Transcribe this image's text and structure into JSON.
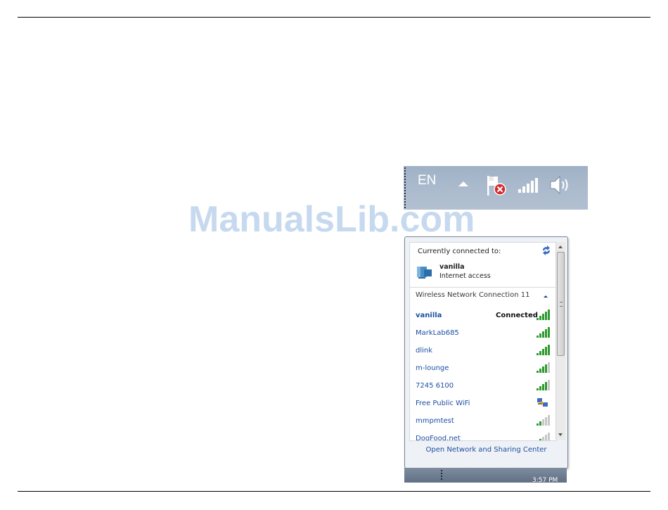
{
  "watermark": "ManualsLib.com",
  "taskbar": {
    "language": "EN",
    "icons": [
      "show-hidden-icons-chevron",
      "action-center-flag-icon",
      "wifi-signal-icon",
      "speaker-icon"
    ]
  },
  "popup": {
    "currently_connected_label": "Currently connected to:",
    "current_network": {
      "name": "vanilla",
      "status": "Internet access"
    },
    "section_title": "Wireless Network Connection 11",
    "networks": [
      {
        "name": "vanilla",
        "state": "Connected",
        "signal": 5,
        "bold": true,
        "icon": "signal"
      },
      {
        "name": "MarkLab685",
        "state": "",
        "signal": 5,
        "icon": "signal"
      },
      {
        "name": "dlink",
        "state": "",
        "signal": 5,
        "icon": "signal"
      },
      {
        "name": "m-lounge",
        "state": "",
        "signal": 4,
        "icon": "signal"
      },
      {
        "name": "7245 6100",
        "state": "",
        "signal": 4,
        "icon": "signal"
      },
      {
        "name": "Free Public WiFi",
        "state": "",
        "signal": 0,
        "icon": "adhoc-computers"
      },
      {
        "name": "mmpmtest",
        "state": "",
        "signal": 2,
        "icon": "signal"
      },
      {
        "name": "DogFood.net",
        "state": "",
        "signal": 2,
        "icon": "signal"
      }
    ],
    "footer_link": "Open Network and Sharing Center"
  },
  "bottom_strip": {
    "time": "3:57 PM"
  },
  "colors": {
    "link": "#1c4fa3",
    "signal_on": "#2f9a2f",
    "signal_off": "#c8c8c8",
    "taskbar": "#a9b9cc"
  }
}
